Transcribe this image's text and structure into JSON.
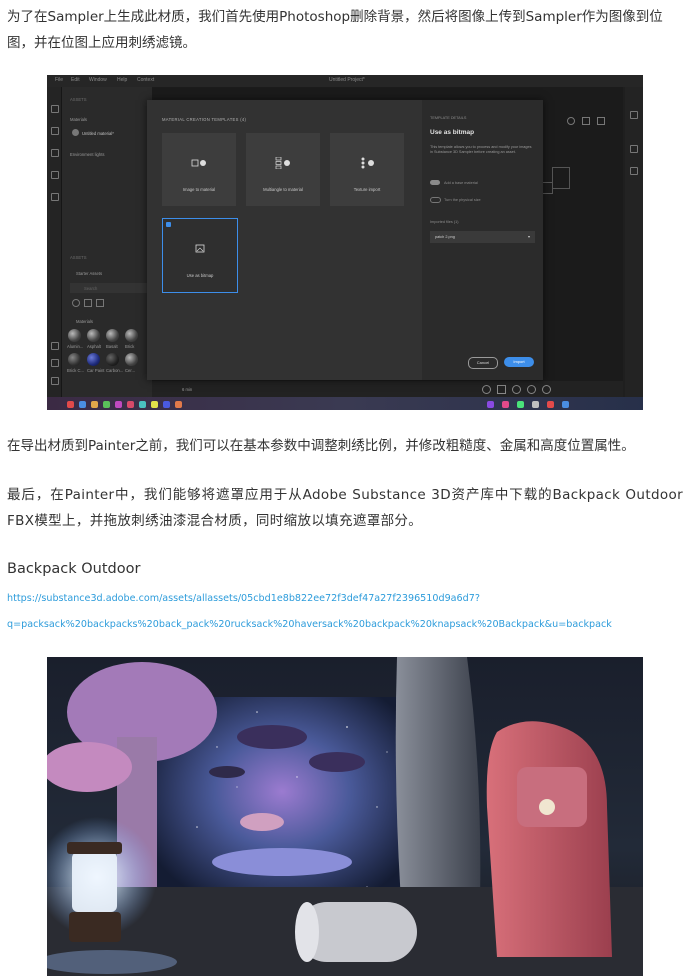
{
  "paragraphs": {
    "p1": "为了在Sampler上生成此材质，我们首先使用Photoshop删除背景，然后将图像上传到Sampler作为图像到位图，并在位图上应用刺绣滤镜。",
    "p2": "在导出材质到Painter之前，我们可以在基本参数中调整刺绣比例，并修改粗糙度、金属和高度位置属性。",
    "p3": "最后，在Painter中，我们能够将遮罩应用于从Adobe Substance 3D资产库中下载的Backpack Outdoor FBX模型上，并拖放刺绣油漆混合材质，同时缩放以填充遮罩部分。"
  },
  "section_heading": "Backpack Outdoor",
  "link": {
    "line1": "https://substance3d.adobe.com/assets/allassets/05cbd1e8b822ee72f3def47a27f2396510d9a6d7?",
    "line2": "q=packsack%20backpacks%20back_pack%20rucksack%20haversack%20backpack%20knapsack%20Backpack&u=backpack"
  },
  "sampler_ui": {
    "menu": [
      "File",
      "Edit",
      "Window",
      "Help",
      "Context"
    ],
    "doc_title": "Untitled Project*",
    "left_panel": {
      "section_layers": "ASSETS",
      "materials_label": "Materials",
      "material_item": "Untitled material*",
      "environment_label": "Environment lights",
      "assets_section": "ASSETS",
      "starter_assets": "Starter Assets",
      "search_placeholder": "Search",
      "materials_sub": "Materials",
      "ball_labels": [
        "Alumin...",
        "Asphalt",
        "Basalt",
        "Brick"
      ],
      "ball_labels_2": [
        "Brick C...",
        "Car Paint",
        "Carbon...",
        "Cer..."
      ]
    },
    "dialog": {
      "title": "MATERIAL CREATION TEMPLATES (4)",
      "cards": [
        {
          "label": "Image to material"
        },
        {
          "label": "Multiangle to material"
        },
        {
          "label": "Texture import"
        },
        {
          "label": "Use as bitmap"
        }
      ],
      "side_top": "TEMPLATE DETAILS",
      "side_title": "Use as bitmap",
      "side_desc": "This template allows you to process and modify your images in Substance 3D Sampler before creating an asset.",
      "toggle1": "Add a base material",
      "toggle2": "Turn the physical size",
      "imported_label": "Imported files (1)",
      "imported_file": "patch 2.png",
      "cancel": "Cancel",
      "import": "Import"
    },
    "bottom_status": "6 min"
  },
  "colors": {
    "link": "#2d9cdb",
    "accent_blue": "#3d8eea",
    "text": "#333333"
  }
}
